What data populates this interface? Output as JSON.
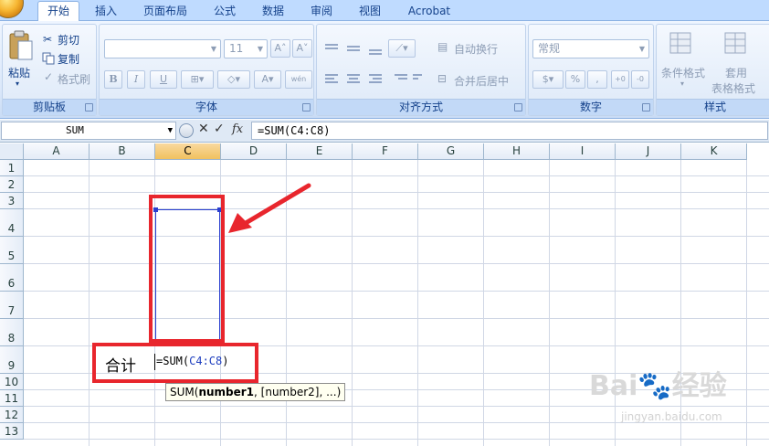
{
  "ribbon_tabs": [
    "开始",
    "插入",
    "页面布局",
    "公式",
    "数据",
    "审阅",
    "视图",
    "Acrobat"
  ],
  "active_tab": "开始",
  "clipboard": {
    "paste": "粘贴",
    "cut": "剪切",
    "copy": "复制",
    "format_painter": "格式刷",
    "label": "剪贴板"
  },
  "font": {
    "size": "11",
    "bold": "B",
    "italic": "I",
    "underline": "U",
    "label": "字体",
    "phonetic": "wén"
  },
  "alignment": {
    "wrap_text": "自动换行",
    "merge_center": "合并后居中",
    "label": "对齐方式"
  },
  "number": {
    "format": "常规",
    "percent": "%",
    "comma": ",",
    "label": "数字"
  },
  "styles": {
    "conditional": "条件格式",
    "table_line1": "套用",
    "table_line2": "表格格式",
    "label": "样式"
  },
  "formula_bar": {
    "name_box": "SUM",
    "formula": "=SUM(C4:C8)",
    "fx": "fx",
    "cancel": "✕",
    "enter": "✓"
  },
  "columns": [
    "A",
    "B",
    "C",
    "D",
    "E",
    "F",
    "G",
    "H",
    "I",
    "J",
    "K"
  ],
  "selected_column": "C",
  "rows": [
    "1",
    "2",
    "3",
    "4",
    "5",
    "6",
    "7",
    "8",
    "9",
    "10",
    "11",
    "12",
    "13"
  ],
  "cells": {
    "b9": "合计",
    "c9_prefix": "=SUM(",
    "c9_ref": "C4:C8",
    "c9_suffix": ")"
  },
  "tooltip": {
    "func": "SUM(",
    "arg1": "number1",
    "rest": ", [number2], ...)"
  },
  "watermark": {
    "brand": "Bai",
    "brand2": "经验",
    "url": "jingyan.baidu.com"
  },
  "colors": {
    "highlight": "#e8262d",
    "range_border": "#2a3fcf",
    "ribbon_bg": "#dbe8fa"
  }
}
